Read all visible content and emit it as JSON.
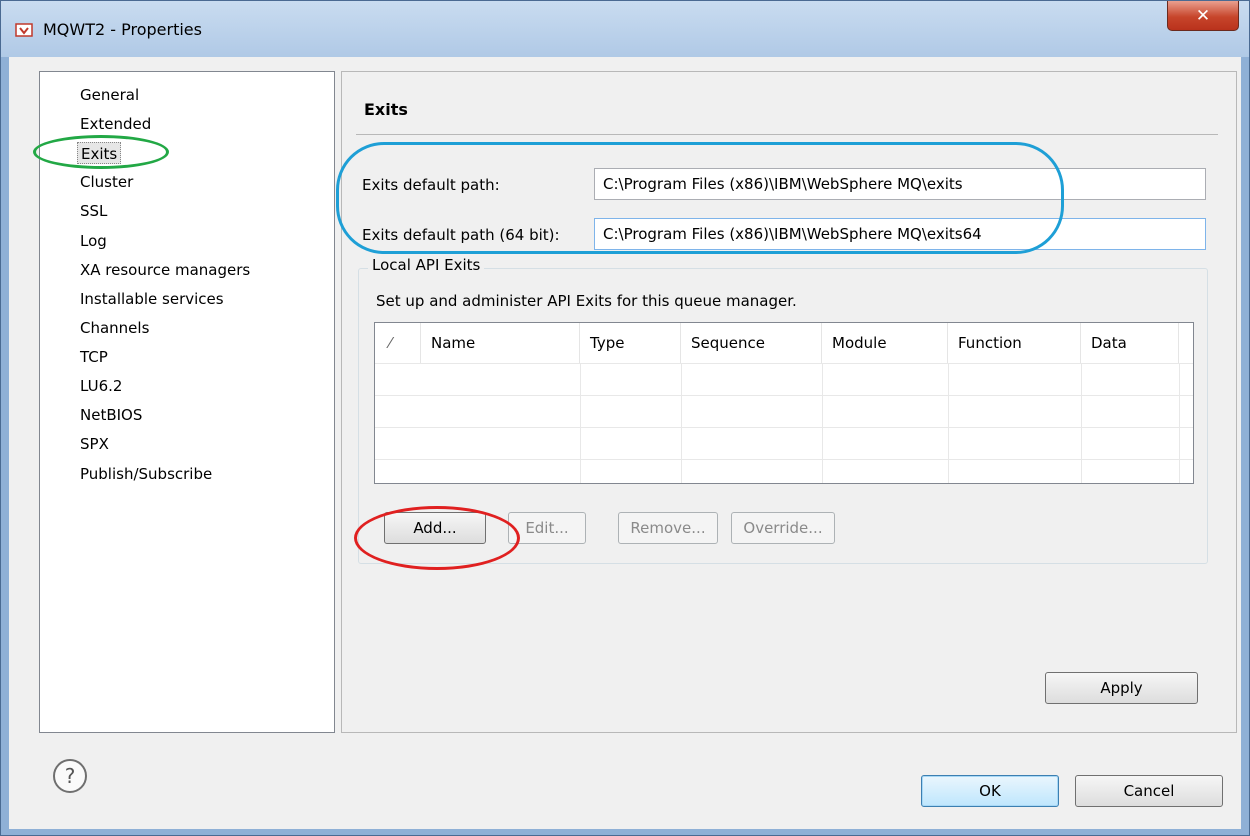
{
  "window": {
    "title": "MQWT2 - Properties",
    "close_glyph": "✕"
  },
  "nav": {
    "items": [
      {
        "label": "General"
      },
      {
        "label": "Extended"
      },
      {
        "label": "Exits"
      },
      {
        "label": "Cluster"
      },
      {
        "label": "SSL"
      },
      {
        "label": "Log"
      },
      {
        "label": "XA resource managers"
      },
      {
        "label": "Installable services"
      },
      {
        "label": "Channels"
      },
      {
        "label": "TCP"
      },
      {
        "label": "LU6.2"
      },
      {
        "label": "NetBIOS"
      },
      {
        "label": "SPX"
      },
      {
        "label": "Publish/Subscribe"
      }
    ],
    "selected": "Exits"
  },
  "page": {
    "title": "Exits",
    "fields": [
      {
        "label": "Exits default path:",
        "value": "C:\\Program Files (x86)\\IBM\\WebSphere MQ\\exits"
      },
      {
        "label": "Exits default path (64 bit):",
        "value": "C:\\Program Files (x86)\\IBM\\WebSphere MQ\\exits64"
      }
    ],
    "group": {
      "legend": "Local API Exits",
      "description": "Set up and administer API Exits for this queue manager.",
      "table": {
        "sort_glyph": "⁄",
        "columns": [
          "Name",
          "Type",
          "Sequence",
          "Module",
          "Function",
          "Data"
        ],
        "rows": []
      },
      "buttons": {
        "add": "Add...",
        "edit": "Edit...",
        "remove": "Remove...",
        "override": "Override..."
      }
    },
    "apply": "Apply"
  },
  "footer": {
    "help_glyph": "?",
    "ok": "OK",
    "cancel": "Cancel"
  },
  "colors": {
    "highlight_nav": "#22a845",
    "highlight_paths": "#1e9fd6",
    "highlight_add": "#e02020"
  }
}
